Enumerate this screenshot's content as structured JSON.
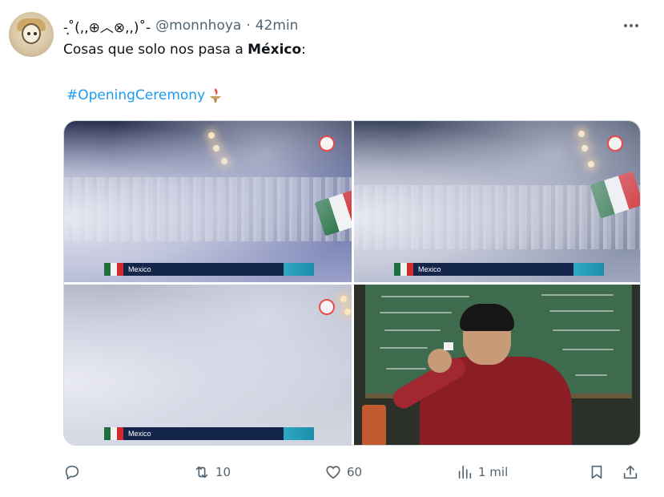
{
  "tweet": {
    "display_name": "-͙˚(,,⊕︿⊗,,)˚-",
    "handle": "@monnhoya",
    "separator": "·",
    "time": "42min",
    "text_prefix": "Cosas que solo nos pasa a ",
    "text_bold": "México",
    "text_suffix": ":",
    "hashtag": "#OpeningCeremony"
  },
  "media": {
    "banner_country": "Mexico"
  },
  "actions": {
    "reply_count": "",
    "retweet_count": "10",
    "like_count": "60",
    "views_count": "1 mil"
  },
  "icons": {
    "more": "more-icon",
    "reply": "reply-icon",
    "retweet": "retweet-icon",
    "like": "heart-icon",
    "views": "views-icon",
    "bookmark": "bookmark-icon",
    "share": "share-icon"
  },
  "colors": {
    "hashtag": "#1d9bf0",
    "secondary_text": "#536471",
    "primary_text": "#0f1419"
  }
}
